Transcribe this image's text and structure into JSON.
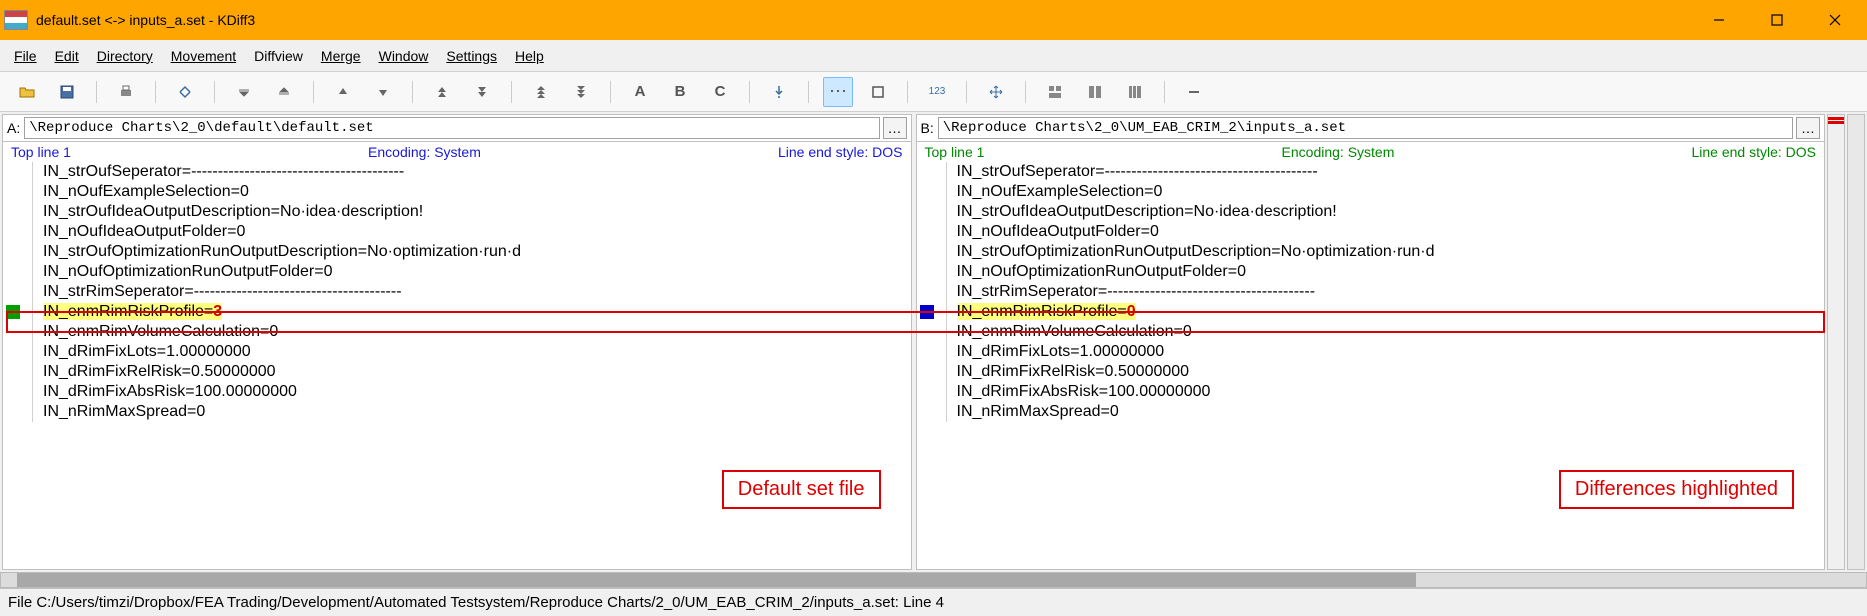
{
  "title": "default.set <-> inputs_a.set - KDiff3",
  "menu": [
    "File",
    "Edit",
    "Directory",
    "Movement",
    "Diffview",
    "Merge",
    "Window",
    "Settings",
    "Help"
  ],
  "tool": {
    "abc": "A",
    "b": "B",
    "c": "C",
    "num": "123"
  },
  "paneA": {
    "label": "A:",
    "path": "\\Reproduce Charts\\2_0\\default\\default.set",
    "topline": "Top line 1",
    "encoding": "Encoding: System",
    "lineend": "Line end style: DOS",
    "lines": [
      "IN_strOufSeperator=----------------------------------------",
      "IN_nOufExampleSelection=0",
      "IN_strOufIdeaOutputDescription=No·idea·description!",
      "IN_nOufIdeaOutputFolder=0",
      "IN_strOufOptimizationRunOutputDescription=No·optimization·run·d",
      "IN_nOufOptimizationRunOutputFolder=0",
      "IN_strRimSeperator=---------------------------------------"
    ],
    "diffPrefix": "IN_enmRimRiskProfile=",
    "diffChar": "3",
    "linesAfter": [
      "IN_enmRimVolumeCalculation=0",
      "IN_dRimFixLots=1.00000000",
      "IN_dRimFixRelRisk=0.50000000",
      "IN_dRimFixAbsRisk=100.00000000",
      "IN_nRimMaxSpread=0"
    ],
    "annotation": "Default set file"
  },
  "paneB": {
    "label": "B:",
    "path": "\\Reproduce Charts\\2_0\\UM_EAB_CRIM_2\\inputs_a.set",
    "topline": "Top line 1",
    "encoding": "Encoding: System",
    "lineend": "Line end style: DOS",
    "lines": [
      "IN_strOufSeperator=----------------------------------------",
      "IN_nOufExampleSelection=0",
      "IN_strOufIdeaOutputDescription=No·idea·description!",
      "IN_nOufIdeaOutputFolder=0",
      "IN_strOufOptimizationRunOutputDescription=No·optimization·run·d",
      "IN_nOufOptimizationRunOutputFolder=0",
      "IN_strRimSeperator=---------------------------------------"
    ],
    "diffPrefix": "IN_enmRimRiskProfile=",
    "diffChar": "0",
    "linesAfter": [
      "IN_enmRimVolumeCalculation=0",
      "IN_dRimFixLots=1.00000000",
      "IN_dRimFixRelRisk=0.50000000",
      "IN_dRimFixAbsRisk=100.00000000",
      "IN_nRimMaxSpread=0"
    ],
    "annotation": "Differences highlighted"
  },
  "status": "File C:/Users/timzi/Dropbox/FEA Trading/Development/Automated Testsystem/Reproduce Charts/2_0/UM_EAB_CRIM_2/inputs_a.set: Line 4"
}
